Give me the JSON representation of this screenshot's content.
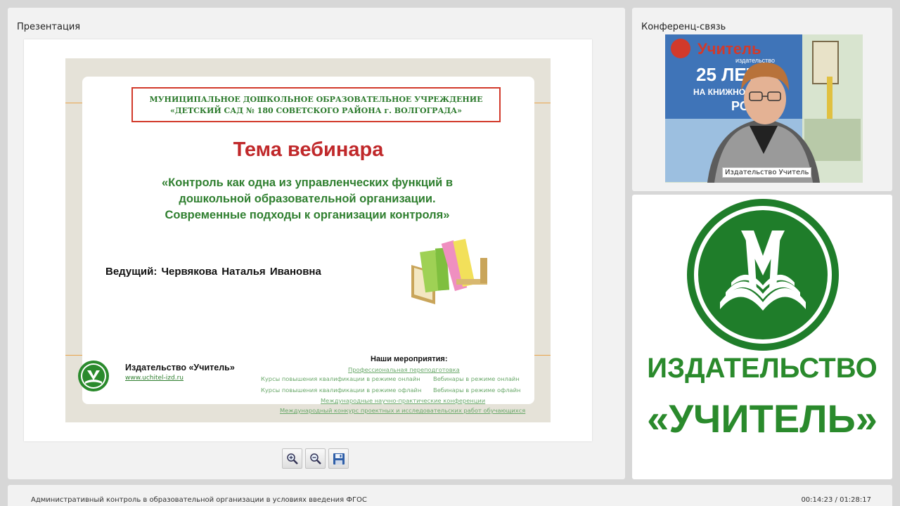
{
  "presentation": {
    "title": "Презентация",
    "slide": {
      "school_line1": "МУНИЦИПАЛЬНОЕ ДОШКОЛЬНОЕ ОБРАЗОВАТЕЛЬНОЕ УЧРЕЖДЕНИЕ",
      "school_line2": "«ДЕТСКИЙ САД № 180 СОВЕТСКОГО РАЙОНА  г. ВОЛГОГРАДА»",
      "heading": "Тема вебинара",
      "topic_line1": "«Контроль как одна из управленческих функций  в",
      "topic_line2": "дошкольной образовательной организации.",
      "topic_line3": "Современные подходы к организации контроля»",
      "host": "Ведущий:  Червякова Наталья Ивановна",
      "publisher": "Издательство «Учитель»",
      "url": "www.uchitel-izd.ru",
      "events_heading": "Наши мероприятия:",
      "events": {
        "e1": "Профессиональная переподготовка",
        "e2": "Курсы повышения квалификации в режиме онлайн",
        "e3": "Вебинары в режиме онлайн",
        "e4": "Курсы повышения квалификации в режиме офлайн",
        "e5": "Вебинары в режиме офлайн",
        "e6": "Международные научно-практические конференции",
        "e7": "Международный конкурс проектных и исследовательских работ обучающихся"
      }
    },
    "toolbar": {
      "zoom_in_icon": "zoom-in-icon",
      "zoom_out_icon": "zoom-out-icon",
      "save_icon": "save-icon"
    }
  },
  "conference": {
    "title": "Конференц-связь",
    "video_label": "Издательство Учитель",
    "banner_text1": "Учитель",
    "banner_text2": "издательство",
    "banner_text3": "25 ЛЕТ",
    "banner_text4": "НА КНИЖНОМ Р",
    "banner_text5": "РОСС"
  },
  "logo": {
    "word1": "ИЗДАТЕЛЬСТВО",
    "word2": "«УЧИТЕЛЬ»"
  },
  "bottom": {
    "title": "Административный контроль в образовательной организации в условиях введения ФГОС",
    "time": "00:14:23 / 01:28:17"
  },
  "colors": {
    "brand_green": "#2a8a2c",
    "heading_red": "#c0282a",
    "accent_orange": "#e9a34a"
  }
}
